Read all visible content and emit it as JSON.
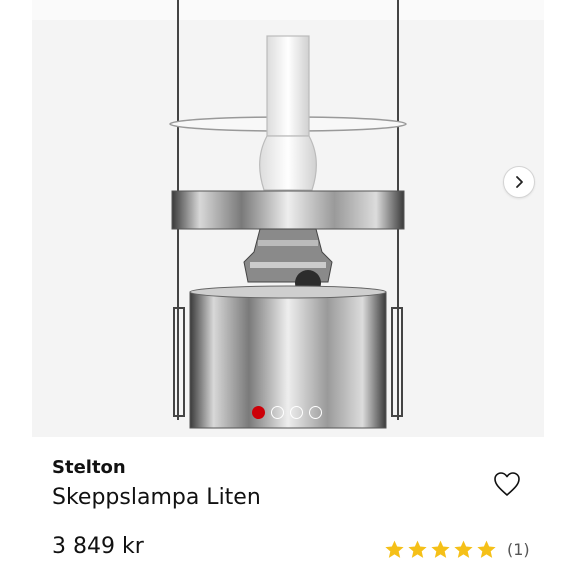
{
  "product": {
    "brand": "Stelton",
    "name": "Skeppslampa Liten",
    "price": "3 849 kr",
    "rating": {
      "stars": 5,
      "review_count": "(1)"
    }
  },
  "gallery": {
    "image_count": 4,
    "active_index": 0
  },
  "icons": {
    "next": "chevron-right-icon",
    "favorite": "heart-outline-icon",
    "star": "star-icon"
  },
  "colors": {
    "star": "#f5c018",
    "active_dot": "#cc0008",
    "gallery_bg": "#f4f4f4"
  }
}
